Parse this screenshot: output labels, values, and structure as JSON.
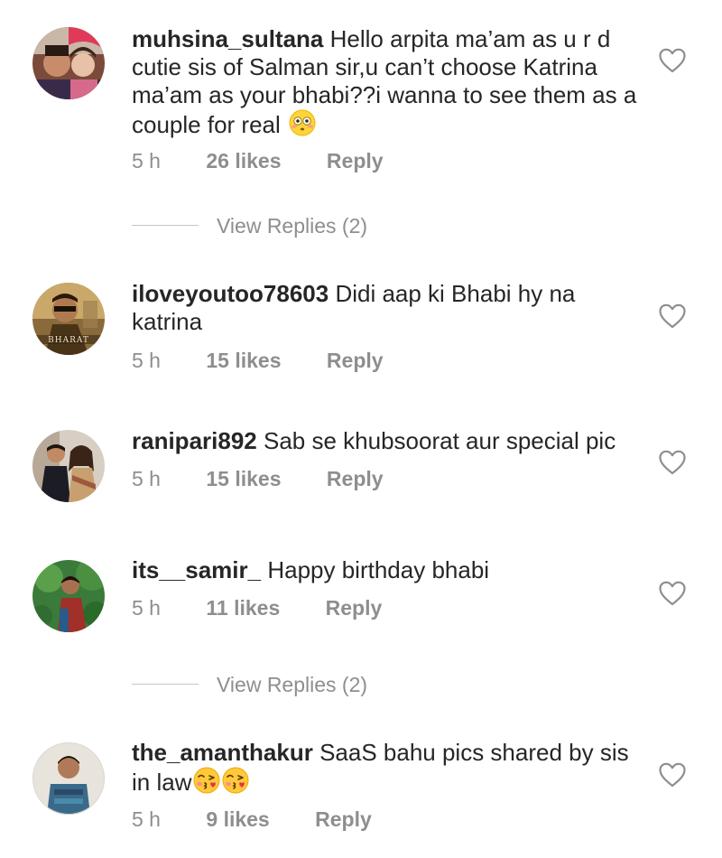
{
  "comments": [
    {
      "username": "muhsina_sultana",
      "text": "Hello arpita ma’am as u r d cutie sis of Salman sir,u can’t choose Katrina ma’am as your bhabi??i wanna to see them as a couple for real",
      "emoji": "flushed-face",
      "time": "5 h",
      "likes": "26 likes",
      "reply": "Reply",
      "view_replies": "View Replies (2)"
    },
    {
      "username": "iloveyoutoo78603",
      "text": "Didi aap ki Bhabi hy na katrina",
      "time": "5 h",
      "likes": "15 likes",
      "reply": "Reply",
      "avatar_text": "BHARAT"
    },
    {
      "username": "ranipari892",
      "text": "Sab se khubsoorat aur special pic",
      "time": "5 h",
      "likes": "15 likes",
      "reply": "Reply"
    },
    {
      "username": "its__samir_",
      "text": "Happy birthday bhabi",
      "time": "5 h",
      "likes": "11 likes",
      "reply": "Reply",
      "view_replies": "View Replies (2)"
    },
    {
      "username": "the_amanthakur",
      "text": "SaaS bahu pics shared by sis in law",
      "emoji": "kissing-face-with-heart",
      "emoji_count": 2,
      "time": "5 h",
      "likes": "9 likes",
      "reply": "Reply"
    }
  ],
  "colors": {
    "text": "#262626",
    "meta": "#8e8e8e",
    "divider": "#c7c7c7",
    "heart_outline": "#8e8e8e"
  }
}
